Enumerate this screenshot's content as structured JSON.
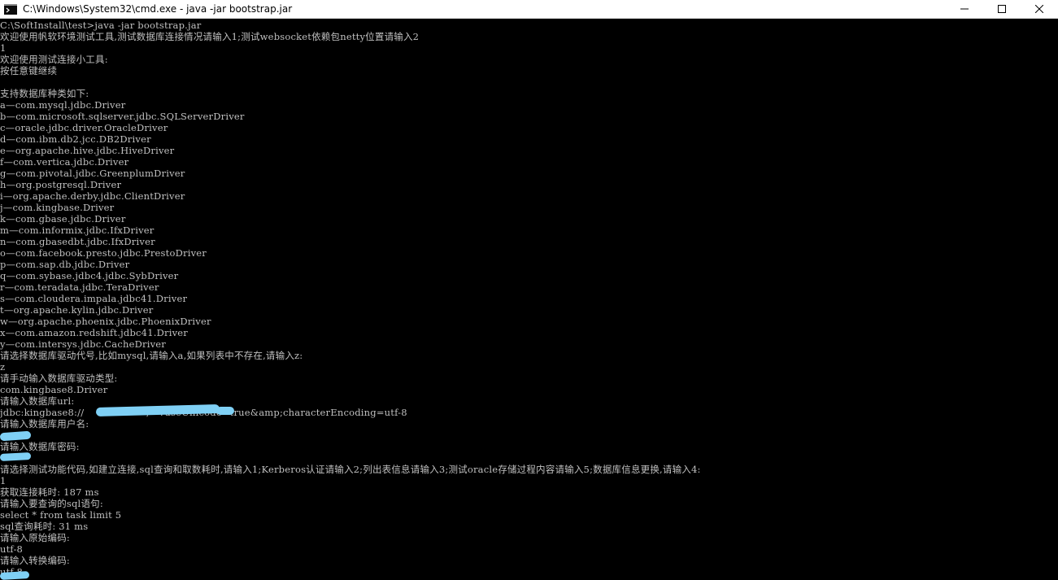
{
  "window": {
    "title": "C:\\Windows\\System32\\cmd.exe - java  -jar bootstrap.jar",
    "icon": "cmd-icon",
    "controls": [
      "minimize-icon",
      "maximize-icon",
      "close-icon"
    ]
  },
  "colors": {
    "background": "#000000",
    "text": "#c0c0c0",
    "redaction": "#7fd0f5"
  },
  "console": {
    "lines": [
      "C:\\SoftInstall\\test>java -jar bootstrap.jar",
      "欢迎使用帆软环境测试工具,测试数据库连接情况请输入1;测试websocket依赖包netty位置请输入2",
      "1",
      "欢迎使用测试连接小工具:",
      "按任意键继续",
      "",
      "支持数据库种类如下:",
      "a—com.mysql.jdbc.Driver",
      "b—com.microsoft.sqlserver.jdbc.SQLServerDriver",
      "c—oracle.jdbc.driver.OracleDriver",
      "d—com.ibm.db2.jcc.DB2Driver",
      "e—org.apache.hive.jdbc.HiveDriver",
      "f—com.vertica.jdbc.Driver",
      "g—com.pivotal.jdbc.GreenplumDriver",
      "h—org.postgresql.Driver",
      "i—org.apache.derby.jdbc.ClientDriver",
      "j—com.kingbase.Driver",
      "k—com.gbase.jdbc.Driver",
      "m—com.informix.jdbc.IfxDriver",
      "n—com.gbasedbt.jdbc.IfxDriver",
      "o—com.facebook.presto.jdbc.PrestoDriver",
      "p—com.sap.db.jdbc.Driver",
      "q—com.sybase.jdbc4.jdbc.SybDriver",
      "r—com.teradata.jdbc.TeraDriver",
      "s—com.cloudera.impala.jdbc41.Driver",
      "t—org.apache.kylin.jdbc.Driver",
      "w—org.apache.phoenix.jdbc.PhoenixDriver",
      "x—com.amazon.redshift.jdbc41.Driver",
      "y—com.intersys.jdbc.CacheDriver",
      "请选择数据库驱动代号,比如mysql,请输入a,如果列表中不存在,请输入z:",
      "z",
      "请手动输入数据库驱动类型:",
      "com.kingbase8.Driver",
      "请输入数据库url:",
      "jdbc:kingbase8://                    /   ?useUnicode=true&amp;characterEncoding=utf-8",
      "请输入数据库用户名:",
      "",
      "请输入数据库密码:",
      "",
      "请选择测试功能代码,如建立连接,sql查询和取数耗时,请输入1;Kerberos认证请输入2;列出表信息请输入3;测试oracle存储过程内容请输入5;数据库信息更换,请输入4:",
      "1",
      "获取连接耗时: 187 ms",
      "请输入要查询的sql语句:",
      "select * from task limit 5",
      "sql查询耗时: 31 ms",
      "请输入原始编码:",
      "utf-8",
      "请输入转换编码:",
      "utf-8",
      ""
    ]
  }
}
